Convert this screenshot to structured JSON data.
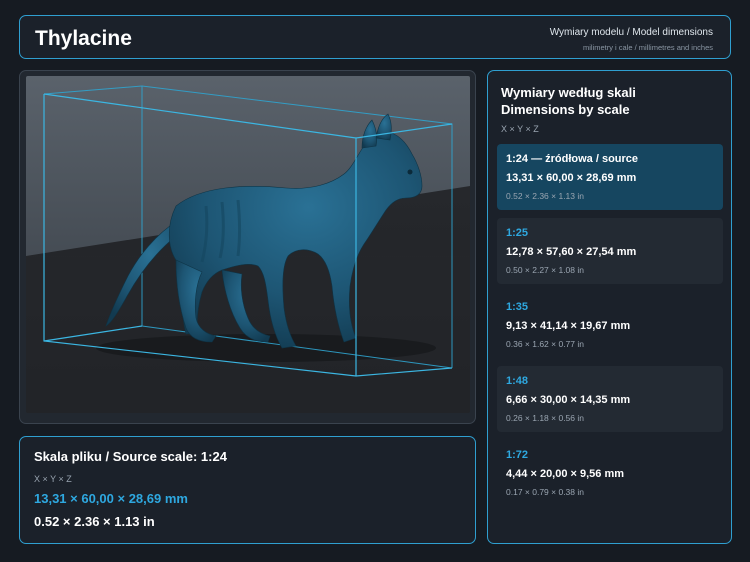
{
  "header": {
    "title": "Thylacine",
    "subtitle": "Wymiary modelu / Model dimensions",
    "units_note": "milimetry i cale / millimetres and inches"
  },
  "viewer": {
    "image_description": "3D render of a thylacine model inside a blue bounding box"
  },
  "source_scale": {
    "title": "Skala pliku / Source scale: 1:24",
    "axes": "X × Y × Z",
    "mm": "13,31 × 60,00 × 28,69 mm",
    "inches": "0.52 × 2.36 × 1.13 in"
  },
  "scales_panel": {
    "title_line1": "Wymiary według skali",
    "title_line2": "Dimensions by scale",
    "axes": "X × Y × Z",
    "items": [
      {
        "label": "1:24  —  źródłowa / source",
        "mm": "13,31 × 60,00 × 28,69 mm",
        "inches": "0.52 × 2.36 × 1.13 in"
      },
      {
        "label": "1:25",
        "mm": "12,78 × 57,60 × 27,54 mm",
        "inches": "0.50 × 2.27 × 1.08 in"
      },
      {
        "label": "1:35",
        "mm": "9,13 × 41,14 × 19,67 mm",
        "inches": "0.36 × 1.62 × 0.77 in"
      },
      {
        "label": "1:48",
        "mm": "6,66 × 30,00 × 14,35 mm",
        "inches": "0.26 × 1.18 × 0.56 in"
      },
      {
        "label": "1:72",
        "mm": "4,44 × 20,00 × 9,56 mm",
        "inches": "0.17 × 0.79 × 0.38 in"
      }
    ]
  },
  "colors": {
    "accent": "#2ea8e0",
    "panel_border": "#2f9fd0",
    "active_card": "#164660",
    "background": "#161b22",
    "model": "#1f5a78"
  }
}
